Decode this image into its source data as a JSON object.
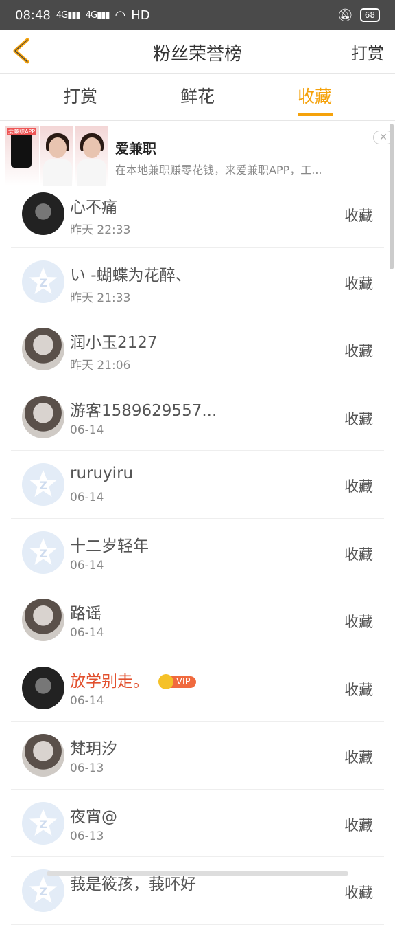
{
  "status_bar": {
    "time": "08:48",
    "net1": "4G",
    "net2": "4G",
    "hd": "HD",
    "battery": "68"
  },
  "header": {
    "title": "粉丝荣誉榜",
    "right_label": "打赏"
  },
  "tabs": [
    {
      "label": "打赏",
      "active": false
    },
    {
      "label": "鲜花",
      "active": false
    },
    {
      "label": "收藏",
      "active": true
    }
  ],
  "ad": {
    "title": "爱兼职",
    "desc": "在本地兼职赚零花钱，来爱兼职APP，工...",
    "tag": "爱兼职APP",
    "close": "✕"
  },
  "list": [
    {
      "name": "心不痛",
      "time": "昨天 22:33",
      "action": "收藏",
      "avatar": "dark",
      "vip": false
    },
    {
      "name": "い -蝴蝶为花醉、",
      "time": "昨天 21:33",
      "action": "收藏",
      "avatar": "default",
      "vip": false
    },
    {
      "name": "润小玉2127",
      "time": "昨天 21:06",
      "action": "收藏",
      "avatar": "photo",
      "vip": false
    },
    {
      "name": "游客1589629557...",
      "time": "06-14",
      "action": "收藏",
      "avatar": "photo",
      "vip": false
    },
    {
      "name": "ruruyiru",
      "time": "06-14",
      "action": "收藏",
      "avatar": "default",
      "vip": false
    },
    {
      "name": "十二岁轻年",
      "time": "06-14",
      "action": "收藏",
      "avatar": "default",
      "vip": false
    },
    {
      "name": "路谣",
      "time": "06-14",
      "action": "收藏",
      "avatar": "photo",
      "vip": false
    },
    {
      "name": "放学别走。",
      "time": "06-14",
      "action": "收藏",
      "avatar": "dark",
      "vip": true,
      "vip_label": "VIP"
    },
    {
      "name": "梵玥汐",
      "time": "06-13",
      "action": "收藏",
      "avatar": "photo",
      "vip": false
    },
    {
      "name": "夜宵@",
      "time": "06-13",
      "action": "收藏",
      "avatar": "default",
      "vip": false
    },
    {
      "name": "莪是筱孩，莪吥好",
      "time": "",
      "action": "收藏",
      "avatar": "default",
      "vip": false
    }
  ],
  "colors": {
    "accent": "#f5a20b",
    "vip_name": "#e2502e"
  }
}
